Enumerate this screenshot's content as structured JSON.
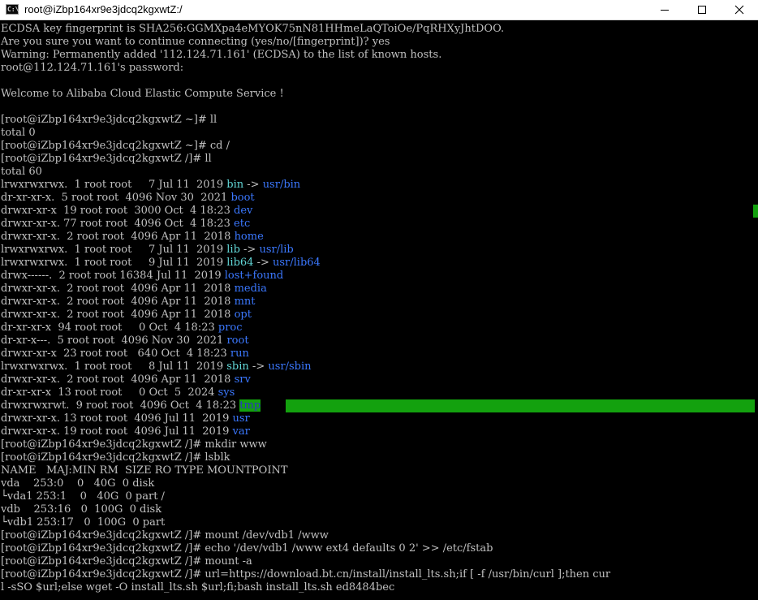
{
  "window": {
    "title": "root@iZbp164xr9e3jdcq2kgxwtZ:/",
    "icon_text": "C:\\"
  },
  "terminal": {
    "lines": [
      [
        {
          "t": "ECDSA key fingerprint is SHA256:GGMXpa4eMYOK75nN81HHmeLaQToiOe/PqRHXyJhtDOO.",
          "c": ""
        }
      ],
      [
        {
          "t": "Are you sure you want to continue connecting (yes/no/[fingerprint])? yes",
          "c": ""
        }
      ],
      [
        {
          "t": "Warning: Permanently added '112.124.71.161' (ECDSA) to the list of known hosts.",
          "c": ""
        }
      ],
      [
        {
          "t": "root@112.124.71.161's password:",
          "c": ""
        }
      ],
      [
        {
          "t": "",
          "c": ""
        }
      ],
      [
        {
          "t": "Welcome to Alibaba Cloud Elastic Compute Service !",
          "c": ""
        }
      ],
      [
        {
          "t": "",
          "c": ""
        }
      ],
      [
        {
          "t": "[root@iZbp164xr9e3jdcq2kgxwtZ ~]# ll",
          "c": ""
        }
      ],
      [
        {
          "t": "total 0",
          "c": ""
        }
      ],
      [
        {
          "t": "[root@iZbp164xr9e3jdcq2kgxwtZ ~]# cd /",
          "c": ""
        }
      ],
      [
        {
          "t": "[root@iZbp164xr9e3jdcq2kgxwtZ /]# ll",
          "c": ""
        }
      ],
      [
        {
          "t": "total 60",
          "c": ""
        }
      ],
      [
        {
          "t": "lrwxrwxrwx.  1 root root     7 Jul 11  2019 ",
          "c": ""
        },
        {
          "t": "bin",
          "c": "cyan"
        },
        {
          "t": " -> ",
          "c": ""
        },
        {
          "t": "usr/bin",
          "c": "blue"
        }
      ],
      [
        {
          "t": "dr-xr-xr-x.  5 root root  4096 Nov 30  2021 ",
          "c": ""
        },
        {
          "t": "boot",
          "c": "blue"
        }
      ],
      [
        {
          "t": "drwxr-xr-x  19 root root  3000 Oct  4 18:23 ",
          "c": ""
        },
        {
          "t": "dev",
          "c": "blue"
        }
      ],
      [
        {
          "t": "drwxr-xr-x. 77 root root  4096 Oct  4 18:23 ",
          "c": ""
        },
        {
          "t": "etc",
          "c": "blue"
        }
      ],
      [
        {
          "t": "drwxr-xr-x.  2 root root  4096 Apr 11  2018 ",
          "c": ""
        },
        {
          "t": "home",
          "c": "blue"
        }
      ],
      [
        {
          "t": "lrwxrwxrwx.  1 root root     7 Jul 11  2019 ",
          "c": ""
        },
        {
          "t": "lib",
          "c": "cyan"
        },
        {
          "t": " -> ",
          "c": ""
        },
        {
          "t": "usr/lib",
          "c": "blue"
        }
      ],
      [
        {
          "t": "lrwxrwxrwx.  1 root root     9 Jul 11  2019 ",
          "c": ""
        },
        {
          "t": "lib64",
          "c": "cyan"
        },
        {
          "t": " -> ",
          "c": ""
        },
        {
          "t": "usr/lib64",
          "c": "blue"
        }
      ],
      [
        {
          "t": "drwx------.  2 root root 16384 Jul 11  2019 ",
          "c": ""
        },
        {
          "t": "lost+found",
          "c": "blue"
        }
      ],
      [
        {
          "t": "drwxr-xr-x.  2 root root  4096 Apr 11  2018 ",
          "c": ""
        },
        {
          "t": "media",
          "c": "blue"
        }
      ],
      [
        {
          "t": "drwxr-xr-x.  2 root root  4096 Apr 11  2018 ",
          "c": ""
        },
        {
          "t": "mnt",
          "c": "blue"
        }
      ],
      [
        {
          "t": "drwxr-xr-x.  2 root root  4096 Apr 11  2018 ",
          "c": ""
        },
        {
          "t": "opt",
          "c": "blue"
        }
      ],
      [
        {
          "t": "dr-xr-xr-x  94 root root     0 Oct  4 18:23 ",
          "c": ""
        },
        {
          "t": "proc",
          "c": "blue"
        }
      ],
      [
        {
          "t": "dr-xr-x---.  5 root root  4096 Nov 30  2021 ",
          "c": ""
        },
        {
          "t": "root",
          "c": "blue"
        }
      ],
      [
        {
          "t": "drwxr-xr-x  23 root root   640 Oct  4 18:23 ",
          "c": ""
        },
        {
          "t": "run",
          "c": "blue"
        }
      ],
      [
        {
          "t": "lrwxrwxrwx.  1 root root     8 Jul 11  2019 ",
          "c": ""
        },
        {
          "t": "sbin",
          "c": "cyan"
        },
        {
          "t": " -> ",
          "c": ""
        },
        {
          "t": "usr/sbin",
          "c": "blue"
        }
      ],
      [
        {
          "t": "drwxr-xr-x.  2 root root  4096 Apr 11  2018 ",
          "c": ""
        },
        {
          "t": "srv",
          "c": "blue"
        }
      ],
      [
        {
          "t": "dr-xr-xr-x  13 root root     0 Oct  5  2024 ",
          "c": ""
        },
        {
          "t": "sys",
          "c": "blue"
        }
      ],
      [
        {
          "t": "drwxrwxrwt.  9 root root  4096 Oct  4 18:23 ",
          "c": ""
        },
        {
          "t": "tmp",
          "c": "tmp"
        }
      ],
      [
        {
          "t": "drwxr-xr-x. 13 root root  4096 Jul 11  2019 ",
          "c": ""
        },
        {
          "t": "usr",
          "c": "blue"
        }
      ],
      [
        {
          "t": "drwxr-xr-x. 19 root root  4096 Jul 11  2019 ",
          "c": ""
        },
        {
          "t": "var",
          "c": "blue"
        }
      ],
      [
        {
          "t": "[root@iZbp164xr9e3jdcq2kgxwtZ /]# mkdir www",
          "c": ""
        }
      ],
      [
        {
          "t": "[root@iZbp164xr9e3jdcq2kgxwtZ /]# lsblk",
          "c": ""
        }
      ],
      [
        {
          "t": "NAME   MAJ:MIN RM  SIZE RO TYPE MOUNTPOINT",
          "c": ""
        }
      ],
      [
        {
          "t": "vda    253:0    0   40G  0 disk",
          "c": ""
        }
      ],
      [
        {
          "t": "└vda1 253:1    0   40G  0 part /",
          "c": ""
        }
      ],
      [
        {
          "t": "vdb    253:16   0  100G  0 disk",
          "c": ""
        }
      ],
      [
        {
          "t": "└vdb1 253:17   0  100G  0 part",
          "c": ""
        }
      ],
      [
        {
          "t": "[root@iZbp164xr9e3jdcq2kgxwtZ /]# mount /dev/vdb1 /www",
          "c": ""
        }
      ],
      [
        {
          "t": "[root@iZbp164xr9e3jdcq2kgxwtZ /]# echo '/dev/vdb1 /www ext4 defaults 0 2' >> /etc/fstab",
          "c": ""
        }
      ],
      [
        {
          "t": "[root@iZbp164xr9e3jdcq2kgxwtZ /]# mount -a",
          "c": ""
        }
      ],
      [
        {
          "t": "[root@iZbp164xr9e3jdcq2kgxwtZ /]# url=https://download.bt.cn/install/install_lts.sh;if [ -f /usr/bin/curl ];then cur",
          "c": ""
        }
      ],
      [
        {
          "t": "l -sSO $url;else wget -O install_lts.sh $url;fi;bash install_lts.sh ed8484bec",
          "c": ""
        }
      ]
    ]
  },
  "colors": {
    "background": "#000000",
    "text": "#c0c0c0",
    "directory_blue": "#3b78ff",
    "symlink_cyan": "#61d6d6",
    "sticky_green": "#13a10e"
  }
}
